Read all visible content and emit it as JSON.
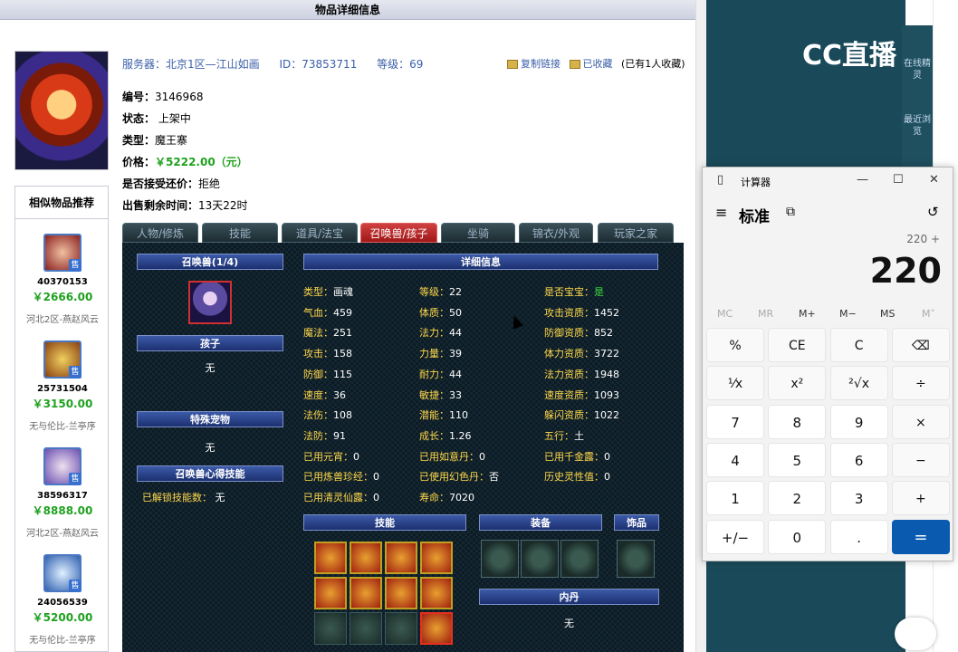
{
  "page": {
    "title": "物品详细信息"
  },
  "item": {
    "server": "服务器：北京1区—江山如画",
    "id": "ID：73853711",
    "level": "等级：69",
    "copy_link": "复制链接",
    "favorited": "已收藏",
    "fav_count": "(已有1人收藏)",
    "number_label": "编号：",
    "number": "3146968",
    "status_label": "状态：",
    "status": "上架中",
    "type_label": "类型：",
    "type": "魔王寨",
    "price_label": "价格：",
    "price": "￥5222.00（元）",
    "bargain_label": "是否接受还价：",
    "bargain": "拒绝",
    "remaining_label": "出售剩余时间：",
    "remaining": "13天22时"
  },
  "similar": {
    "title": "相似物品推荐",
    "items": [
      {
        "id": "40370153",
        "price": "￥2666.00",
        "server": "河北2区-燕赵风云",
        "tag": "售"
      },
      {
        "id": "25731504",
        "price": "￥3150.00",
        "server": "无与伦比-兰亭序",
        "tag": "售"
      },
      {
        "id": "38596317",
        "price": "￥8888.00",
        "server": "河北2区-燕赵风云",
        "tag": "售"
      },
      {
        "id": "24056539",
        "price": "￥5200.00",
        "server": "无与伦比-兰亭序",
        "tag": "售"
      }
    ]
  },
  "tabs": [
    "人物/修炼",
    "技能",
    "道具/法宝",
    "召唤兽/孩子",
    "坐骑",
    "锦衣/外观",
    "玩家之家"
  ],
  "pet": {
    "header": "召唤兽(1/4)",
    "child_header": "孩子",
    "child_value": "无",
    "special_header": "特殊宠物",
    "special_value": "无",
    "skill_header": "召唤兽心得技能",
    "unlocked_label": "已解锁技能数：",
    "unlocked_value": "无",
    "detail_header": "详细信息",
    "col1": [
      {
        "k": "类型：",
        "v": "画魂"
      },
      {
        "k": "气血：",
        "v": "459"
      },
      {
        "k": "魔法：",
        "v": "251"
      },
      {
        "k": "攻击：",
        "v": "158"
      },
      {
        "k": "防御：",
        "v": "115"
      },
      {
        "k": "速度：",
        "v": "36"
      },
      {
        "k": "法伤：",
        "v": "108"
      },
      {
        "k": "法防：",
        "v": "91"
      },
      {
        "k": "已用元宵：",
        "v": "0"
      },
      {
        "k": "已用炼兽珍经：",
        "v": "0"
      },
      {
        "k": "已用清灵仙露：",
        "v": "0"
      }
    ],
    "col2": [
      {
        "k": "等级：",
        "v": "22"
      },
      {
        "k": "体质：",
        "v": "50"
      },
      {
        "k": "法力：",
        "v": "44"
      },
      {
        "k": "力量：",
        "v": "39"
      },
      {
        "k": "耐力：",
        "v": "44"
      },
      {
        "k": "敏捷：",
        "v": "33"
      },
      {
        "k": "潜能：",
        "v": "110"
      },
      {
        "k": "成长：",
        "v": "1.26"
      },
      {
        "k": "已用如意丹：",
        "v": "0"
      },
      {
        "k": "已使用幻色丹：",
        "v": "否"
      },
      {
        "k": "寿命：",
        "v": "7020"
      }
    ],
    "col3": [
      {
        "k": "是否宝宝：",
        "v": "是"
      },
      {
        "k": "攻击资质：",
        "v": "1452"
      },
      {
        "k": "防御资质：",
        "v": "852"
      },
      {
        "k": "体力资质：",
        "v": "3722"
      },
      {
        "k": "法力资质：",
        "v": "1948"
      },
      {
        "k": "速度资质：",
        "v": "1093"
      },
      {
        "k": "躲闪资质：",
        "v": "1022"
      },
      {
        "k": "五行：",
        "v": "土"
      },
      {
        "k": "已用千金露：",
        "v": "0"
      },
      {
        "k": "历史灵性值：",
        "v": "0"
      }
    ],
    "skills_header": "技能",
    "equip_header": "装备",
    "accessory_header": "饰品",
    "inner_header": "内丹",
    "inner_value": "无"
  },
  "cc": {
    "logo": "CC直播",
    "online": "在线精灵",
    "recent": "最近浏览"
  },
  "calculator": {
    "title": "计算器",
    "mode": "标准",
    "expression": "220 +",
    "display": "220",
    "memory": [
      "MC",
      "MR",
      "M+",
      "M−",
      "MS",
      "M˅"
    ],
    "keys": [
      "%",
      "CE",
      "C",
      "⌫",
      "¹⁄x",
      "x²",
      "²√x",
      "÷",
      "7",
      "8",
      "9",
      "×",
      "4",
      "5",
      "6",
      "−",
      "1",
      "2",
      "3",
      "+",
      "+/−",
      "0",
      ".",
      "="
    ]
  },
  "colors": {
    "accent": "#0a5ab0",
    "price": "#1fa11f",
    "stat_label": "#ffd84a",
    "active_tab": "#c02828"
  }
}
